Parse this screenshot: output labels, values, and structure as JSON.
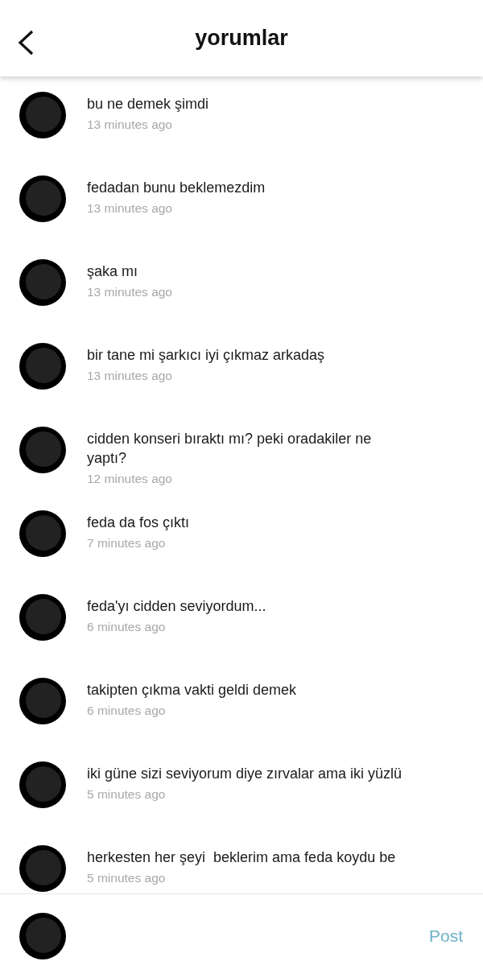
{
  "header": {
    "title": "yorumlar"
  },
  "comments": [
    {
      "text": "bu ne demek şimdi",
      "time": "13 minutes ago"
    },
    {
      "text": "fedadan bunu beklemezdim",
      "time": "13 minutes ago"
    },
    {
      "text": "şaka mı",
      "time": "13 minutes ago"
    },
    {
      "text": "bir tane mi şarkıcı iyi çıkmaz arkadaş",
      "time": "13 minutes ago"
    },
    {
      "text": "cidden konseri bıraktı mı? peki oradakiler ne yaptı?",
      "time": "12 minutes ago"
    },
    {
      "text": "feda da fos çıktı",
      "time": "7 minutes ago"
    },
    {
      "text": "feda'yı cidden seviyordum...",
      "time": "6 minutes ago"
    },
    {
      "text": "takipten çıkma vakti geldi demek",
      "time": "6 minutes ago"
    },
    {
      "text": "iki güne sizi seviyorum diye zırvalar ama iki yüzlü",
      "time": "5 minutes ago"
    },
    {
      "text": "herkesten her şeyi  beklerim ama feda koydu be",
      "time": "5 minutes ago"
    }
  ],
  "composer": {
    "post_button": "Post"
  }
}
